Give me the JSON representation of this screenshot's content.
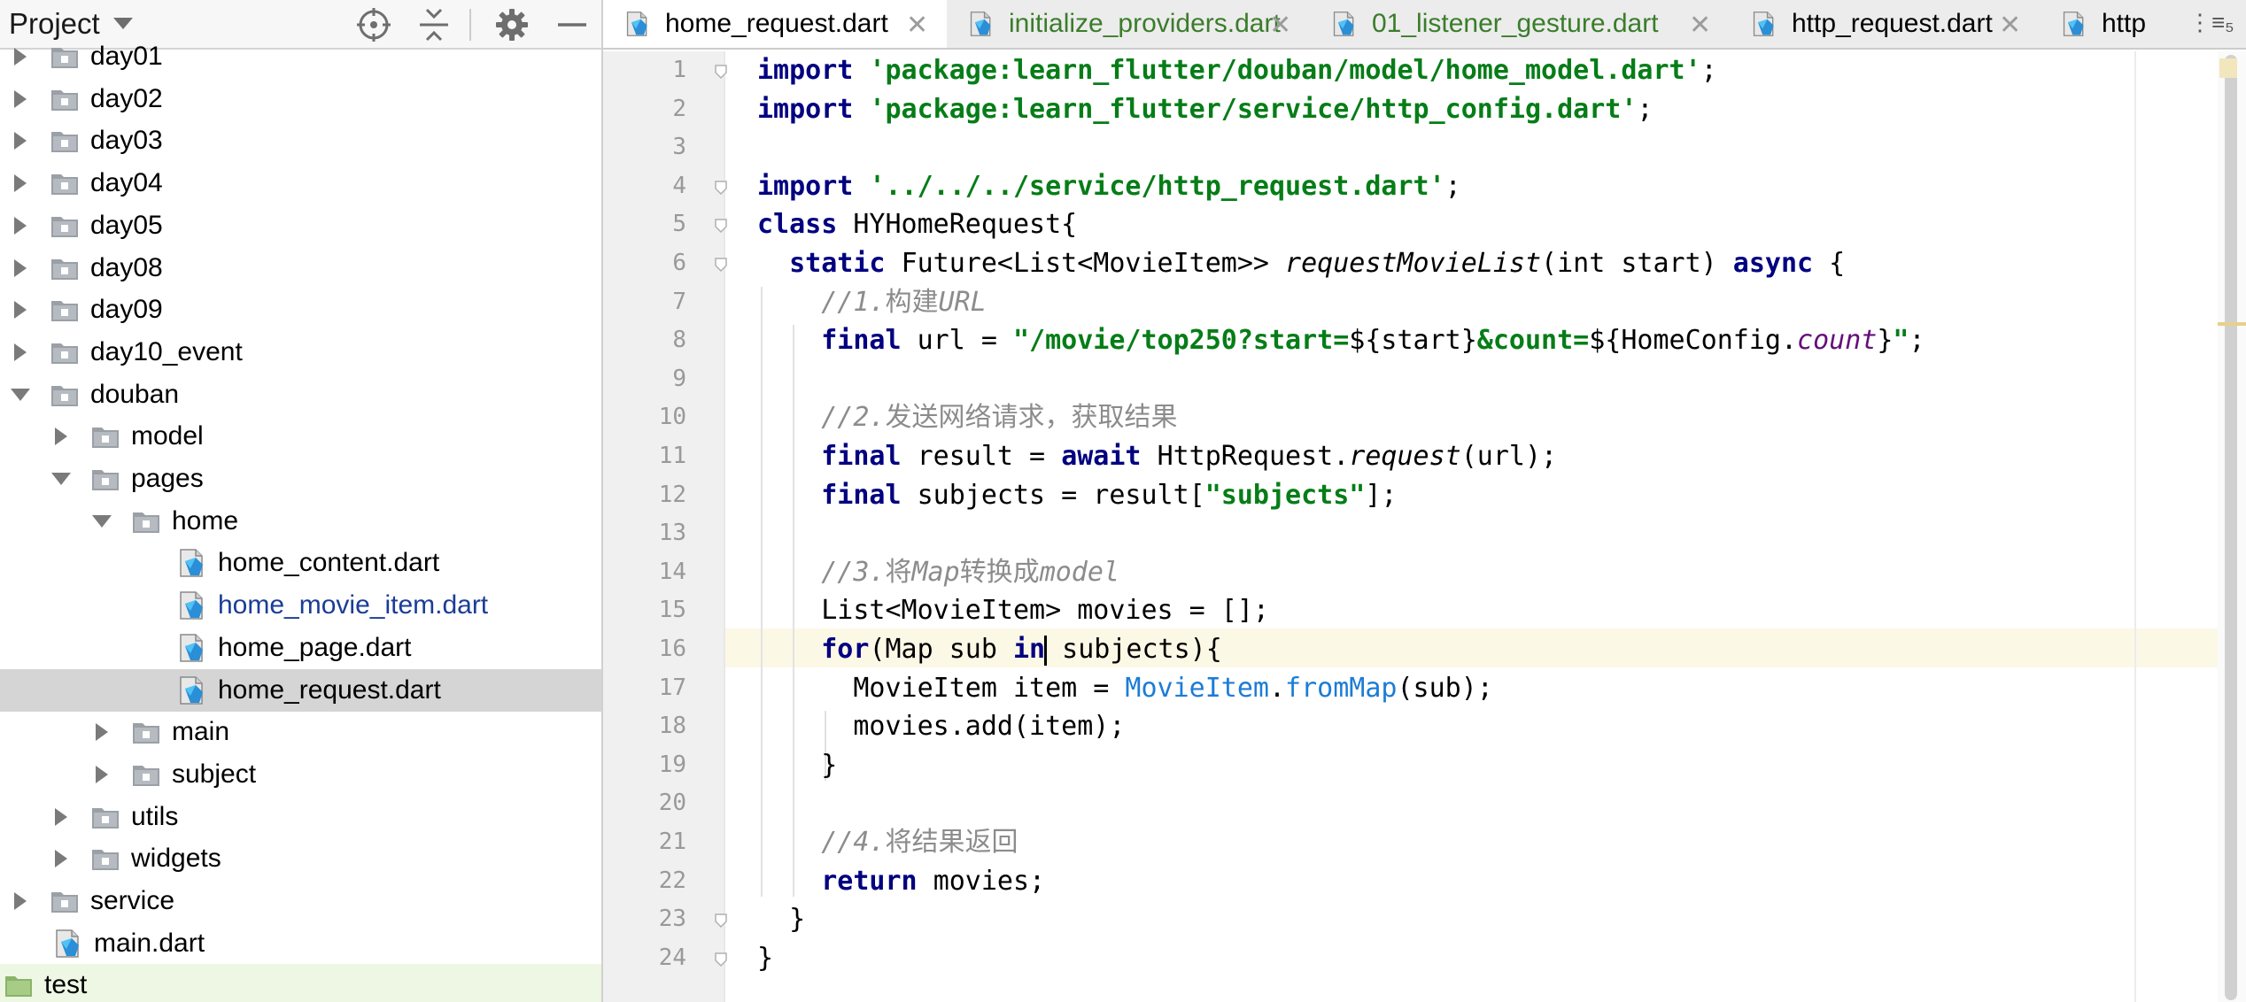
{
  "project_panel": {
    "title": "Project",
    "tools": [
      "locate-icon",
      "collapse-all-icon",
      "gear-icon",
      "hide-icon"
    ],
    "tree": [
      {
        "label": "day01",
        "type": "folder",
        "expanded": false
      },
      {
        "label": "day02",
        "type": "folder",
        "expanded": false
      },
      {
        "label": "day03",
        "type": "folder",
        "expanded": false
      },
      {
        "label": "day04",
        "type": "folder",
        "expanded": false
      },
      {
        "label": "day05",
        "type": "folder",
        "expanded": false
      },
      {
        "label": "day08",
        "type": "folder",
        "expanded": false
      },
      {
        "label": "day09",
        "type": "folder",
        "expanded": false
      },
      {
        "label": "day10_event",
        "type": "folder",
        "expanded": false
      },
      {
        "label": "douban",
        "type": "folder",
        "expanded": true
      },
      {
        "label": "model",
        "type": "folder",
        "expanded": false
      },
      {
        "label": "pages",
        "type": "folder",
        "expanded": true
      },
      {
        "label": "home",
        "type": "folder",
        "expanded": true
      },
      {
        "label": "home_content.dart",
        "type": "dart-file"
      },
      {
        "label": "home_movie_item.dart",
        "type": "dart-file",
        "modified": true
      },
      {
        "label": "home_page.dart",
        "type": "dart-file"
      },
      {
        "label": "home_request.dart",
        "type": "dart-file",
        "selected": true
      },
      {
        "label": "main",
        "type": "folder",
        "expanded": false
      },
      {
        "label": "subject",
        "type": "folder",
        "expanded": false
      },
      {
        "label": "utils",
        "type": "folder",
        "expanded": false
      },
      {
        "label": "widgets",
        "type": "folder",
        "expanded": false
      },
      {
        "label": "service",
        "type": "folder",
        "expanded": false
      },
      {
        "label": "main.dart",
        "type": "dart-file"
      },
      {
        "label": "test",
        "type": "test-folder"
      }
    ]
  },
  "editor": {
    "tabs": [
      {
        "label": "home_request.dart",
        "active": true,
        "modified": false
      },
      {
        "label": "initialize_providers.dart",
        "active": false,
        "modified": true
      },
      {
        "label": "01_listener_gesture.dart",
        "active": false,
        "modified": true
      },
      {
        "label": "http_request.dart",
        "active": false,
        "modified": false
      },
      {
        "label": "http",
        "active": false,
        "modified": false
      }
    ],
    "tab_overflow": "⋮≡₅",
    "current_line": 16,
    "lines": [
      [
        {
          "t": "import ",
          "c": "kw"
        },
        {
          "t": "'package:learn_flutter/douban/model/home_model.dart'",
          "c": "str"
        },
        {
          "t": ";",
          "c": ""
        }
      ],
      [
        {
          "t": "import ",
          "c": "kw"
        },
        {
          "t": "'package:learn_flutter/service/http_config.dart'",
          "c": "str"
        },
        {
          "t": ";",
          "c": ""
        }
      ],
      [],
      [
        {
          "t": "import ",
          "c": "kw"
        },
        {
          "t": "'../../../service/http_request.dart'",
          "c": "str"
        },
        {
          "t": ";",
          "c": ""
        }
      ],
      [
        {
          "t": "class ",
          "c": "kw"
        },
        {
          "t": "HYHomeRequest{",
          "c": ""
        }
      ],
      [
        {
          "t": "  ",
          "c": ""
        },
        {
          "t": "static ",
          "c": "kw"
        },
        {
          "t": "Future<List<MovieItem>> ",
          "c": ""
        },
        {
          "t": "requestMovieList",
          "c": "it"
        },
        {
          "t": "(int start) ",
          "c": ""
        },
        {
          "t": "async",
          "c": "kw"
        },
        {
          "t": " {",
          "c": ""
        }
      ],
      [
        {
          "t": "    ",
          "c": ""
        },
        {
          "t": "//1.",
          "c": "cm"
        },
        {
          "t": "构建",
          "c": "cm-cn"
        },
        {
          "t": "URL",
          "c": "cm"
        }
      ],
      [
        {
          "t": "    ",
          "c": ""
        },
        {
          "t": "final ",
          "c": "kw"
        },
        {
          "t": "url = ",
          "c": ""
        },
        {
          "t": "\"/movie/top250?start=",
          "c": "str"
        },
        {
          "t": "${start}",
          "c": ""
        },
        {
          "t": "&count=",
          "c": "str"
        },
        {
          "t": "${HomeConfig.",
          "c": ""
        },
        {
          "t": "count",
          "c": "fld"
        },
        {
          "t": "}",
          "c": ""
        },
        {
          "t": "\"",
          "c": "str"
        },
        {
          "t": ";",
          "c": ""
        }
      ],
      [],
      [
        {
          "t": "    ",
          "c": ""
        },
        {
          "t": "//2.",
          "c": "cm"
        },
        {
          "t": "发送网络请求，获取结果",
          "c": "cm-cn"
        }
      ],
      [
        {
          "t": "    ",
          "c": ""
        },
        {
          "t": "final ",
          "c": "kw"
        },
        {
          "t": "result = ",
          "c": ""
        },
        {
          "t": "await ",
          "c": "kw"
        },
        {
          "t": "HttpRequest.",
          "c": ""
        },
        {
          "t": "request",
          "c": "it"
        },
        {
          "t": "(url);",
          "c": ""
        }
      ],
      [
        {
          "t": "    ",
          "c": ""
        },
        {
          "t": "final ",
          "c": "kw"
        },
        {
          "t": "subjects = result[",
          "c": ""
        },
        {
          "t": "\"subjects\"",
          "c": "str"
        },
        {
          "t": "];",
          "c": ""
        }
      ],
      [],
      [
        {
          "t": "    ",
          "c": ""
        },
        {
          "t": "//3.",
          "c": "cm"
        },
        {
          "t": "将",
          "c": "cm-cn"
        },
        {
          "t": "Map",
          "c": "cm"
        },
        {
          "t": "转换成",
          "c": "cm-cn"
        },
        {
          "t": "model",
          "c": "cm"
        }
      ],
      [
        {
          "t": "    ",
          "c": ""
        },
        {
          "t": "List<MovieItem> movies = [];",
          "c": ""
        }
      ],
      [
        {
          "t": "    ",
          "c": ""
        },
        {
          "t": "for",
          "c": "kw"
        },
        {
          "t": "(Map sub ",
          "c": ""
        },
        {
          "t": "in",
          "c": "kw"
        },
        {
          "t": "|caret|",
          "c": "caret"
        },
        {
          "t": " subjects){",
          "c": ""
        }
      ],
      [
        {
          "t": "      ",
          "c": ""
        },
        {
          "t": "MovieItem item = ",
          "c": ""
        },
        {
          "t": "MovieItem",
          "c": "cls-ref"
        },
        {
          "t": ".",
          "c": ""
        },
        {
          "t": "fromMap",
          "c": "cls-ref"
        },
        {
          "t": "(sub);",
          "c": ""
        }
      ],
      [
        {
          "t": "      ",
          "c": ""
        },
        {
          "t": "movies.add(item);",
          "c": ""
        }
      ],
      [
        {
          "t": "    ",
          "c": ""
        },
        {
          "t": "}",
          "c": ""
        }
      ],
      [],
      [
        {
          "t": "    ",
          "c": ""
        },
        {
          "t": "//4.",
          "c": "cm"
        },
        {
          "t": "将结果返回",
          "c": "cm-cn"
        }
      ],
      [
        {
          "t": "    ",
          "c": ""
        },
        {
          "t": "return ",
          "c": "kw"
        },
        {
          "t": "movies;",
          "c": ""
        }
      ],
      [
        {
          "t": "  ",
          "c": ""
        },
        {
          "t": "}",
          "c": ""
        }
      ],
      [
        {
          "t": "}",
          "c": ""
        }
      ]
    ]
  }
}
